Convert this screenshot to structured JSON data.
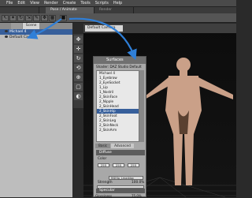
{
  "menu": [
    "File",
    "Edit",
    "View",
    "Render",
    "Create",
    "Tools",
    "Scripts",
    "Help"
  ],
  "top_tabs": {
    "left": "",
    "center": "Pose / Animate",
    "right": "Render"
  },
  "toolbar": {
    "camera": "Default Camera"
  },
  "scene_panel": {
    "tabs": [
      "Scene"
    ],
    "items": [
      "Michael 4",
      "Default Camera"
    ],
    "selected_item": "Michael 4"
  },
  "surfaces_panel": {
    "title": "Surfaces",
    "shader": "Shader: DAZ Studio Default",
    "root": "Michael 4",
    "items": [
      "1_Eyebrow",
      "2_EyeSocket",
      "1_Lip",
      "1_Nostril",
      "2_SkinFace",
      "2_Nipple",
      "2_SkinHead",
      "2_SkinHip",
      "2_SkinFoot",
      "2_SkinLeg",
      "2_SkinNeck",
      "2_SkinArm"
    ],
    "selected_item": "2_SkinHip",
    "tabs": [
      "Basic",
      "Advanced"
    ],
    "active_tab": "Advanced",
    "diffuse": {
      "header": "Diffuse",
      "color_label": "Color",
      "color_values": [
        "255",
        "255",
        "255"
      ],
      "map": "M4Hip_Lmaddox",
      "strength_label": "Strength",
      "strength_value": "100.0%"
    },
    "specular": {
      "header": "Specular",
      "glossiness_label": "Glossiness",
      "glossiness_value": "75.0%"
    }
  },
  "colors": {
    "selection": "#375f9b",
    "arrow": "#2f7fd8",
    "viewport_bg": "#0f0f0f"
  }
}
